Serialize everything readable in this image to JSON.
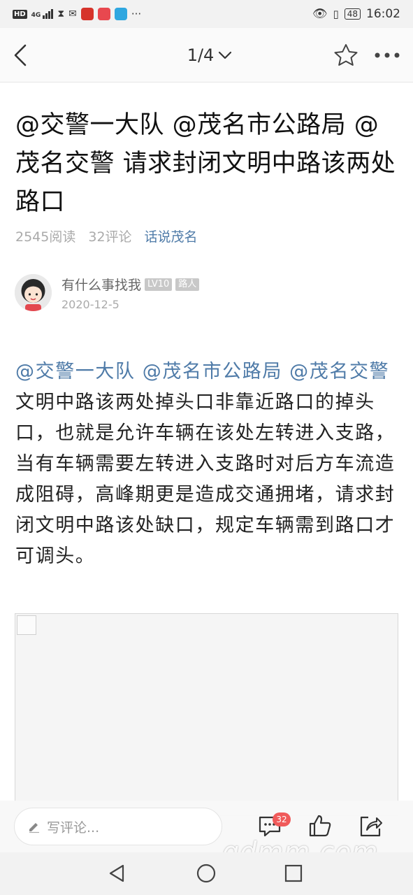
{
  "status_bar": {
    "network_badge": "HD",
    "signal_label": "4G",
    "battery": "48",
    "time": "16:02",
    "more": "···"
  },
  "nav": {
    "page_indicator": "1/4",
    "icons": [
      "back-icon",
      "chevron-down-icon",
      "star-icon",
      "more-icon"
    ]
  },
  "article": {
    "title": "@交警一大队 @茂名市公路局 @茂名交警 请求封闭文明中路该两处路口",
    "reads": "2545阅读",
    "comments": "32评论",
    "topic": "话说茂名",
    "author": {
      "name": "有什么事找我",
      "level": "LV10",
      "rank": "路人",
      "date": "2020-12-5"
    },
    "body_mentions": "@交警一大队 @茂名市公路局 @茂名交警",
    "body_text": " 文明中路该两处掉头口非靠近路口的掉头口，也就是允许车辆在该处左转进入支路，当有车辆需要左转进入支路时对后方车流造成阻碍，高峰期更是造成交通拥堵，请求封闭文明中路该处缺口，规定车辆需到路口才可调头。"
  },
  "action_bar": {
    "comment_placeholder": "写评论...",
    "comment_count": "32",
    "icons": [
      "pencil-icon",
      "comment-icon",
      "like-icon",
      "share-icon"
    ]
  },
  "watermark": "gdmm.com",
  "colors": {
    "link": "#4f7ba8",
    "badge": "#f05a5a",
    "text": "#222222"
  }
}
